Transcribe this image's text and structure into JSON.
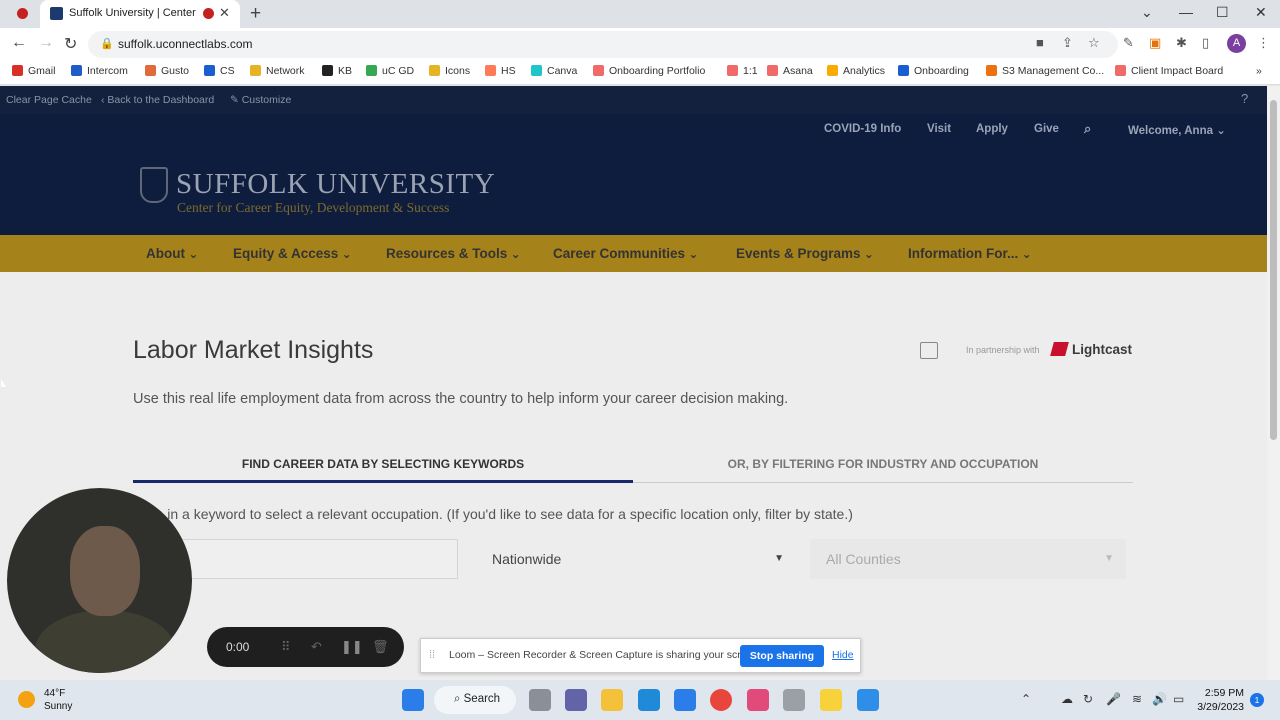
{
  "browser": {
    "tab_title": "Suffolk University | Center fo",
    "url": "suffolk.uconnectlabs.com",
    "avatar_letter": "A",
    "bookmarks": [
      {
        "label": "Gmail",
        "color": "#d93025"
      },
      {
        "label": "Intercom",
        "color": "#1f5cc7"
      },
      {
        "label": "Gusto",
        "color": "#e06a3a"
      },
      {
        "label": "CS",
        "color": "#1a5fd0"
      },
      {
        "label": "Network",
        "color": "#e6b422"
      },
      {
        "label": "KB",
        "color": "#222222"
      },
      {
        "label": "uC GD",
        "color": "#34a853"
      },
      {
        "label": "Icons",
        "color": "#e6b422"
      },
      {
        "label": "HS",
        "color": "#ff7a59"
      },
      {
        "label": "Canva",
        "color": "#20c4cb"
      },
      {
        "label": "Onboarding Portfolio",
        "color": "#f06a6a"
      },
      {
        "label": "1:1",
        "color": "#f06a6a"
      },
      {
        "label": "Asana",
        "color": "#f06a6a"
      },
      {
        "label": "Analytics",
        "color": "#f9ab00"
      },
      {
        "label": "Onboarding",
        "color": "#1a5fd0"
      },
      {
        "label": "S3 Management Co...",
        "color": "#ec7211"
      },
      {
        "label": "Client Impact Board",
        "color": "#f06a6a"
      }
    ]
  },
  "admin_bar": {
    "clear_cache": "Clear Page Cache",
    "back": "‹ Back to the Dashboard",
    "customize": "Customize"
  },
  "header": {
    "links": [
      "COVID-19 Info",
      "Visit",
      "Apply",
      "Give"
    ],
    "welcome": "Welcome, Anna",
    "logo_name": "SUFFOLK UNIVERSITY",
    "logo_sub": "Center for Career Equity, Development & Success"
  },
  "nav": [
    "About",
    "Equity & Access",
    "Resources & Tools",
    "Career Communities",
    "Events & Programs",
    "Information For..."
  ],
  "main": {
    "title": "Labor Market Insights",
    "partner_text": "In partnership with",
    "partner_name": "Lightcast",
    "intro": "Use this real life employment data from across the country to help inform your career decision making.",
    "tab_keywords": "FIND CAREER DATA BY SELECTING KEYWORDS",
    "tab_filter": "OR, BY FILTERING FOR INDUSTRY AND OCCUPATION",
    "hint": "Type in a keyword to select a relevant occupation. (If you'd like to see data for a specific location only, filter by state.)",
    "state_value": "Nationwide",
    "county_value": "All Counties"
  },
  "loom": {
    "time": "0:00",
    "message": "Loom – Screen Recorder & Screen Capture is sharing your screen.",
    "stop": "Stop sharing",
    "hide": "Hide"
  },
  "taskbar": {
    "temp": "44°F",
    "condition": "Sunny",
    "search": "Search",
    "time": "2:59 PM",
    "date": "3/29/2023",
    "notifications": "1"
  }
}
